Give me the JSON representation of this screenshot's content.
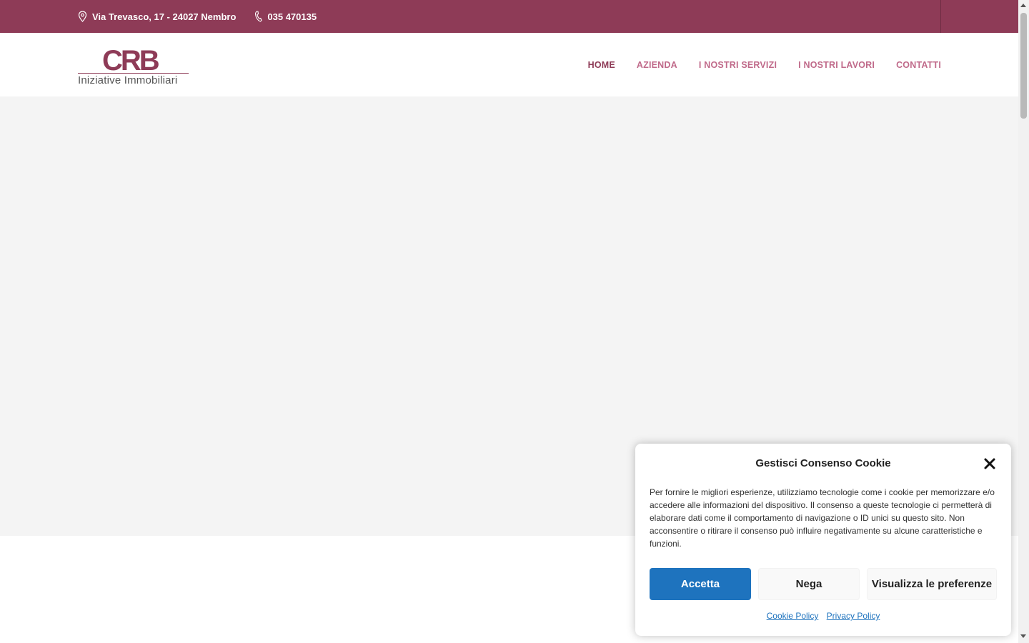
{
  "topbar": {
    "address": "Via Trevasco, 17 - 24027 Nembro",
    "phone": "035 470135",
    "background": "#8e3b57"
  },
  "logo": {
    "mark": "CRB",
    "subtitle": "Iniziative Immobiliari"
  },
  "nav": {
    "items": [
      {
        "label": "HOME",
        "active": true
      },
      {
        "label": "AZIENDA"
      },
      {
        "label": "I NOSTRI SERVIZI"
      },
      {
        "label": "I NOSTRI LAVORI"
      },
      {
        "label": "CONTATTI"
      }
    ]
  },
  "cookie": {
    "title": "Gestisci Consenso Cookie",
    "text": "Per fornire le migliori esperienze, utilizziamo tecnologie come i cookie per memorizzare e/o accedere alle informazioni del dispositivo. Il consenso a queste tecnologie ci permetterà di elaborare dati come il comportamento di navigazione o ID unici su questo sito. Non acconsentire o ritirare il consenso può influire negativamente su alcune caratteristiche e funzioni.",
    "accept_label": "Accetta",
    "deny_label": "Nega",
    "prefs_label": "Visualizza le preferenze",
    "cookie_policy_label": "Cookie Policy",
    "privacy_policy_label": "Privacy Policy",
    "accent": "#1e73be"
  }
}
